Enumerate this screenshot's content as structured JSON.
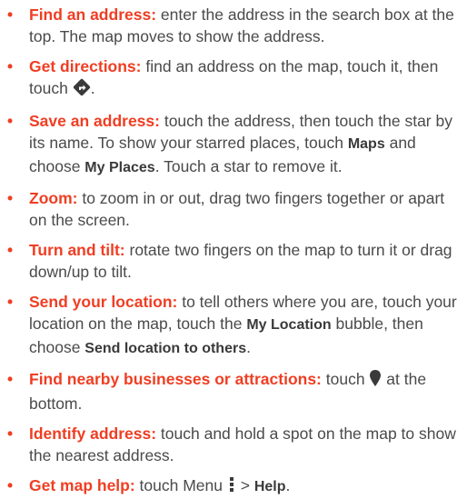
{
  "items": [
    {
      "term": "Find an address:",
      "t1": " enter the address in the search box at the top. The map moves to show the address."
    },
    {
      "term": "Get directions:",
      "t1": " find an address on the map, touch it, then touch ",
      "t2": "."
    },
    {
      "term": "Save an address:",
      "t1": " touch the address, then touch the star by its name. To show your starred places, touch ",
      "b1": "Maps",
      "t2": " and choose ",
      "b2": "My Places",
      "t3": ". Touch a star to remove it."
    },
    {
      "term": "Zoom:",
      "t1": " to zoom in or out, drag two fingers together or apart on the screen."
    },
    {
      "term": "Turn and tilt:",
      "t1": " rotate two fingers on the map to turn it or drag down/up to tilt."
    },
    {
      "term": "Send your location:",
      "t1": " to tell others where you are, touch your location on the map, touch the ",
      "b1": "My Location",
      "t2": " bubble, then choose ",
      "b2": "Send location to others",
      "t3": "."
    },
    {
      "term": "Find nearby businesses or attractions:",
      "t1": " touch ",
      "t2": " at the bottom."
    },
    {
      "term": "Identify address:",
      "t1": " touch and hold a spot on the map to show the nearest address."
    },
    {
      "term": "Get map help:",
      "t1": " touch Menu ",
      "t2": " > ",
      "b1": "Help",
      "t3": "."
    }
  ],
  "bullet": "•",
  "icons": [
    "directions-icon",
    "location-pin-icon",
    "menu-dots-icon"
  ],
  "colors": {
    "accent": "#ef3e23",
    "text": "#4a4a4a"
  }
}
